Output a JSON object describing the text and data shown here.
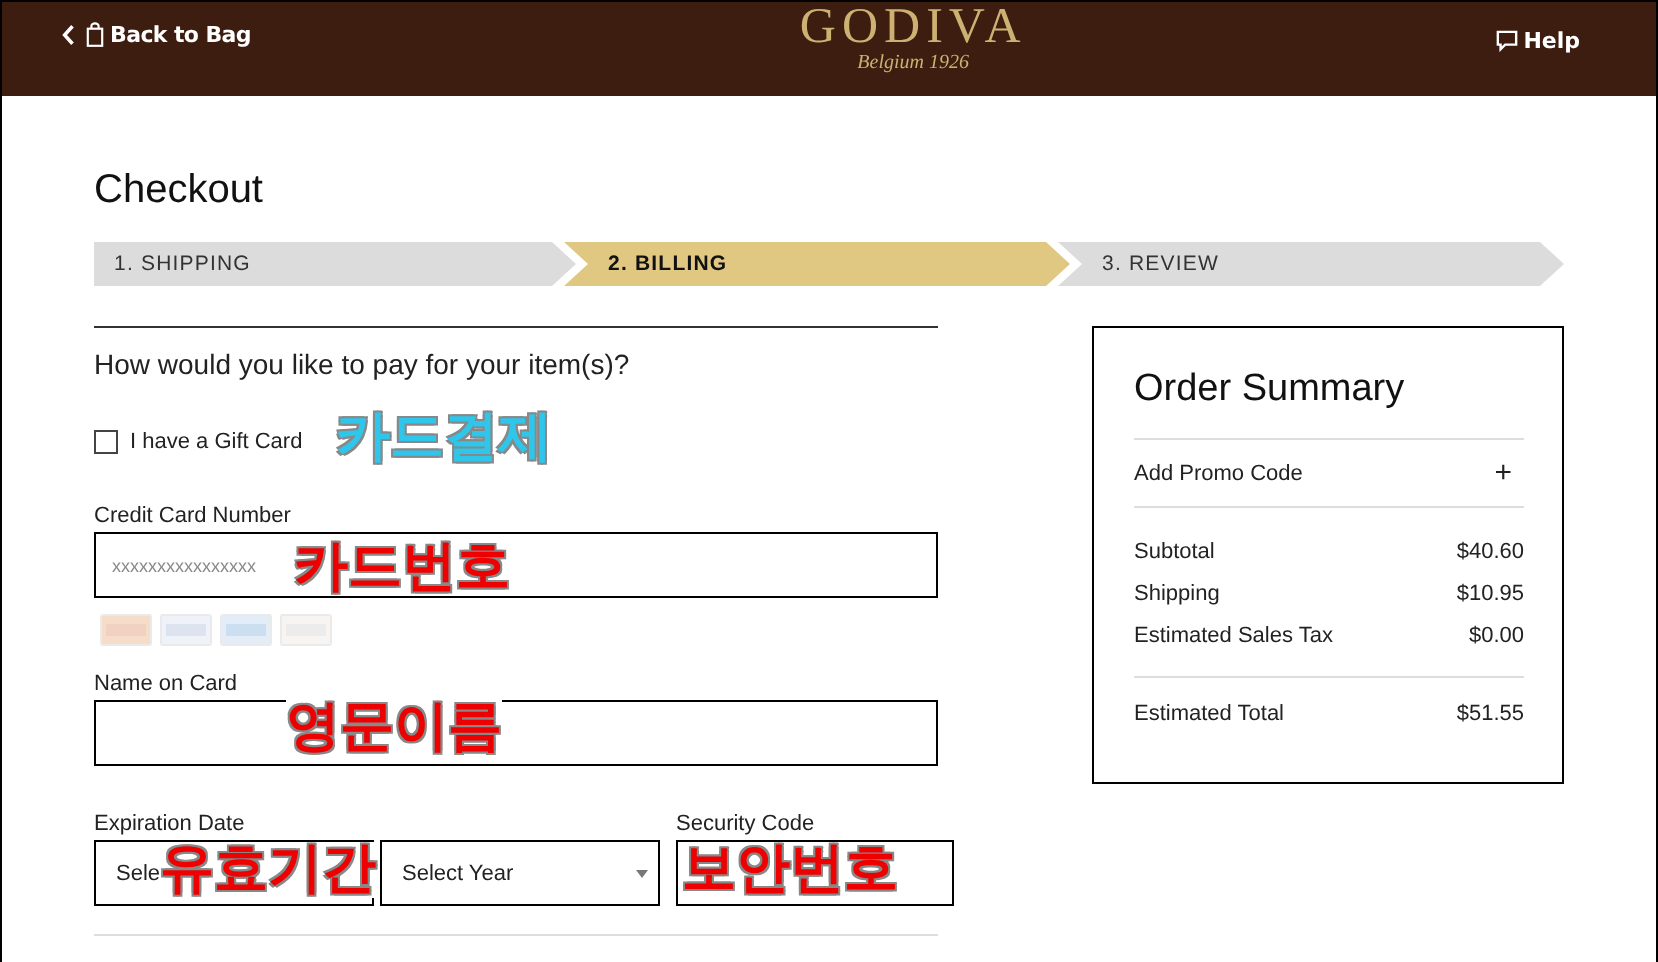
{
  "header": {
    "back_link": "Back to Bag",
    "brand": "GODIVA",
    "tagline": "Belgium 1926",
    "help_link": "Help"
  },
  "page_title": "Checkout",
  "steps": [
    {
      "label": "1. SHIPPING",
      "selected": false
    },
    {
      "label": "2. BILLING",
      "selected": true
    },
    {
      "label": "3. REVIEW",
      "selected": false
    }
  ],
  "payment": {
    "question": "How would you like to pay for your item(s)?",
    "gift_card": {
      "label": "I have a Gift Card",
      "checked": false
    },
    "card_number": {
      "label": "Credit Card Number",
      "placeholder": "xxxxxxxxxxxxxxxx"
    },
    "name_on_card": {
      "label": "Name on Card"
    },
    "expiration": {
      "label": "Expiration Date",
      "month": "Sele",
      "year": "Select Year"
    },
    "security_code": {
      "label": "Security Code"
    }
  },
  "annotations": [
    {
      "text": "카드결제",
      "color": "#2ec6ea",
      "kind": "gift"
    },
    {
      "text": "카드번호",
      "color": "#ee0000",
      "kind": "number"
    },
    {
      "text": "영문이름",
      "color": "#ee0000",
      "kind": "name"
    },
    {
      "text": "유효기간",
      "color": "#ee0000",
      "kind": "expiry"
    },
    {
      "text": "보안번호",
      "color": "#ee0000",
      "kind": "security"
    }
  ],
  "order_summary": {
    "title": "Order Summary",
    "promo": "Add Promo Code",
    "promo_icon": "+",
    "lines": [
      {
        "label": "Subtotal",
        "value": "$40.60"
      },
      {
        "label": "Shipping",
        "value": "$10.95"
      },
      {
        "label": "Estimated Sales Tax",
        "value": "$0.00"
      }
    ],
    "total": {
      "label": "Estimated Total",
      "value": "$51.55"
    }
  }
}
